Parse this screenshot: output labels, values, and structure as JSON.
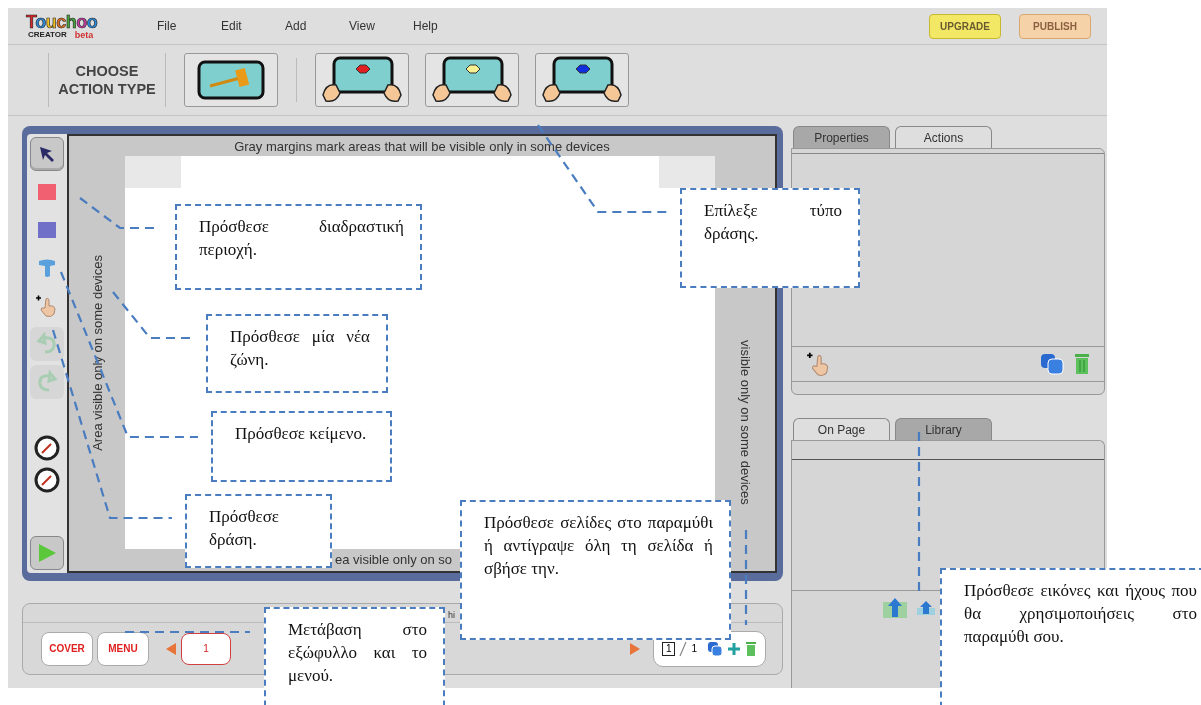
{
  "menu_bar": {
    "logo": {
      "name": "Touchoo",
      "subtitle": "CREATOR",
      "badge": "beta"
    },
    "menus": [
      "File",
      "Edit",
      "Add",
      "View",
      "Help"
    ],
    "buttons": [
      {
        "label": "UPGRADE",
        "kind": "upgrade"
      },
      {
        "label": "PUBLISH",
        "kind": "publish"
      }
    ]
  },
  "action_toolbar": {
    "label": "CHOOSE ACTION TYPE",
    "actions": [
      {
        "kind": "hammer"
      },
      {
        "kind": "tap-red"
      },
      {
        "kind": "tap-yellow"
      },
      {
        "kind": "tap-blue"
      }
    ]
  },
  "tools": [
    {
      "kind": "pointer",
      "selected": true,
      "disabled": false
    },
    {
      "kind": "hotspot",
      "selected": false,
      "disabled": false
    },
    {
      "kind": "zone",
      "selected": false,
      "disabled": false
    },
    {
      "kind": "text",
      "selected": false,
      "disabled": false
    },
    {
      "kind": "add-action",
      "selected": false,
      "disabled": false
    },
    {
      "kind": "undo",
      "selected": false,
      "disabled": true
    },
    {
      "kind": "redo",
      "selected": false,
      "disabled": true
    },
    {
      "kind": "gauge",
      "selected": false,
      "disabled": false
    },
    {
      "kind": "gauge",
      "selected": false,
      "disabled": false
    },
    {
      "kind": "play",
      "selected": false,
      "disabled": false
    }
  ],
  "canvas": {
    "top_note": "Gray margins mark areas that will be visible only in some devices",
    "left_note": "Area visible only on some devices",
    "right_note": "visible only on some devices",
    "bottom_note": "ea visible only on so"
  },
  "properties_panel": {
    "tabs": [
      {
        "label": "Properties",
        "selected": false
      },
      {
        "label": "Actions",
        "selected": true
      }
    ]
  },
  "assets_panel": {
    "tabs": [
      {
        "label": "On Page",
        "selected": true
      },
      {
        "label": "Library",
        "selected": false
      }
    ]
  },
  "page_bar": {
    "caption": "hi",
    "buttons": [
      "COVER",
      "MENU"
    ],
    "page_field": {
      "value": "1"
    },
    "pager": {
      "current": "1",
      "total": "1"
    }
  },
  "callouts": [
    {
      "text": "Πρόσθεσε διαδραστική περιοχή."
    },
    {
      "text": "Πρόσθεσε μία νέα ζώνη."
    },
    {
      "text": "Πρόσθεσε κείμενο."
    },
    {
      "text": "Πρόσθεσε δράση."
    },
    {
      "text": "Επίλεξε τύπο δράσης."
    },
    {
      "text": "Πρόσθεσε σελίδες στο παραμύθι ή αντίγραψε όλη τη σελίδα ή σβήσε την."
    },
    {
      "text": "Μετάβαση στο εξώφυλλο και το μενού."
    },
    {
      "text": "Πρόσθεσε εικόνες και ήχους που θα χρησιμοποιήσεις στο παραμύθι σου."
    }
  ]
}
